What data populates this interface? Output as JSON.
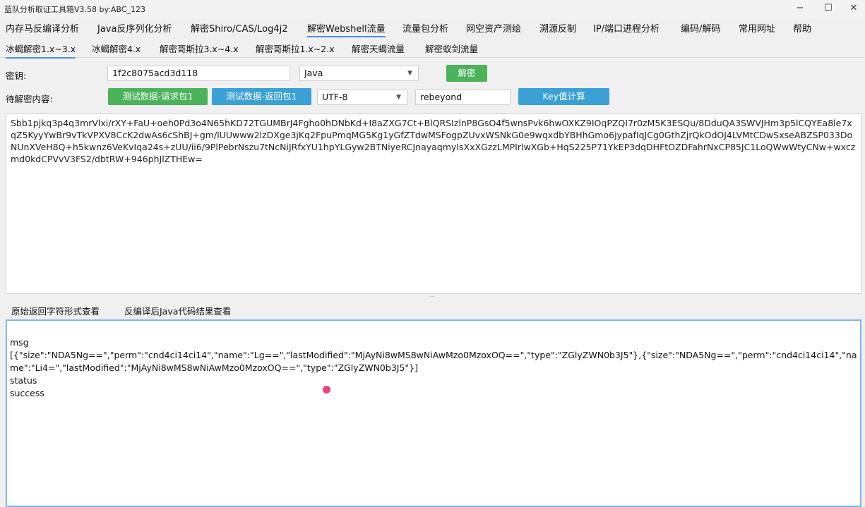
{
  "window": {
    "title": "蓝队分析取证工具箱V3.58 by:ABC_123",
    "min": "−",
    "max": "☐",
    "close": "✕"
  },
  "menu": [
    "内存马反编译分析",
    "Java反序列化分析",
    "解密Shiro/CAS/Log4j2",
    "解密Webshell流量",
    "流量包分析",
    "网空资产测绘",
    "溯源反制",
    "IP/端口进程分析",
    "编码/解码",
    "常用网址",
    "帮助"
  ],
  "subtabs": [
    "冰蝎解密1.x~3.x",
    "冰蝎解密4.x",
    "解密哥斯拉3.x~4.x",
    "解密哥斯拉1.x~2.x",
    "解密天蝎流量",
    "解密蚁剑流量"
  ],
  "form": {
    "key_label": "密钥:",
    "key_value": "1f2c8075acd3d118",
    "lang_value": "Java",
    "decrypt_button": "解密",
    "content_label": "待解密内容:",
    "test_request_button": "测试数据-请求包1",
    "test_response_button": "测试数据-返回包1",
    "encoding_value": "UTF-8",
    "password_value": "rebeyond",
    "key_calc_button": "Key值计算"
  },
  "input_text": "Sbb1pjkq3p4q3mrVlxi/rXY+FaU+oeh0Pd3o4N65hKD72TGUMBrJ4Fgho0hDNbKd+I8aZXG7Ct+BlQRSIzlnP8GsO4f5wnsPvk6hwOXKZ9IOqPZQI7r0zM5K3ESQu/8DduQA3SWVJHm3p5lCQYEa8le7xqZ5KyyYwBr9vTkVPXV8CcK2dwAs6cShBJ+gm/lUUwww2lzDXge3jKq2FpuPmqMG5Kg1yGfZTdwMSFogpZUvxWSNkG0e9wqxdbYBHhGmo6jypafIqJCg0GthZjrQkOdOJ4LVMtCDwSxseABZSP033DoNUnXVeH8Q+h5kwnz6VeKvIqa24s+zUU/ii6/9PlPebrNszu7tNcNiJRfxYU1hpYLGyw2BTNiyeRCJnayaqmyIsXxXGzzLMPIrlwXGb+HqS225P71YkEP3dqDHFtOZDFahrNxCP85JC1LoQWwWtyCNw+wxczmd0kdCPVvV3FS2/dbtRW+946phJlZTHEw=",
  "bottom_tabs": [
    "原始返回字符形式查看",
    "反编译后Java代码结果查看"
  ],
  "output": {
    "line1": "msg",
    "line2": "[{\"size\":\"NDA5Ng==\",\"perm\":\"cnd4ci14ci14\",\"name\":\"Lg==\",\"lastModified\":\"MjAyNi8wMS8wNiAwMzo0MzoxOQ==\",\"type\":\"ZGlyZWN0b3J5\"},{\"size\":\"NDA5Ng==\",\"perm\":\"cnd4ci14ci14\",\"name\":\"Li4=\",\"lastModified\":\"MjAyNi8wMS8wNiAwMzo0MzoxOQ==\",\"type\":\"ZGlyZWN0b3J5\"}]",
    "line3": "status",
    "line4": "success"
  },
  "colors": {
    "green": "#4bb35a",
    "blue": "#3aa0d6",
    "accent": "#4a90d9"
  }
}
